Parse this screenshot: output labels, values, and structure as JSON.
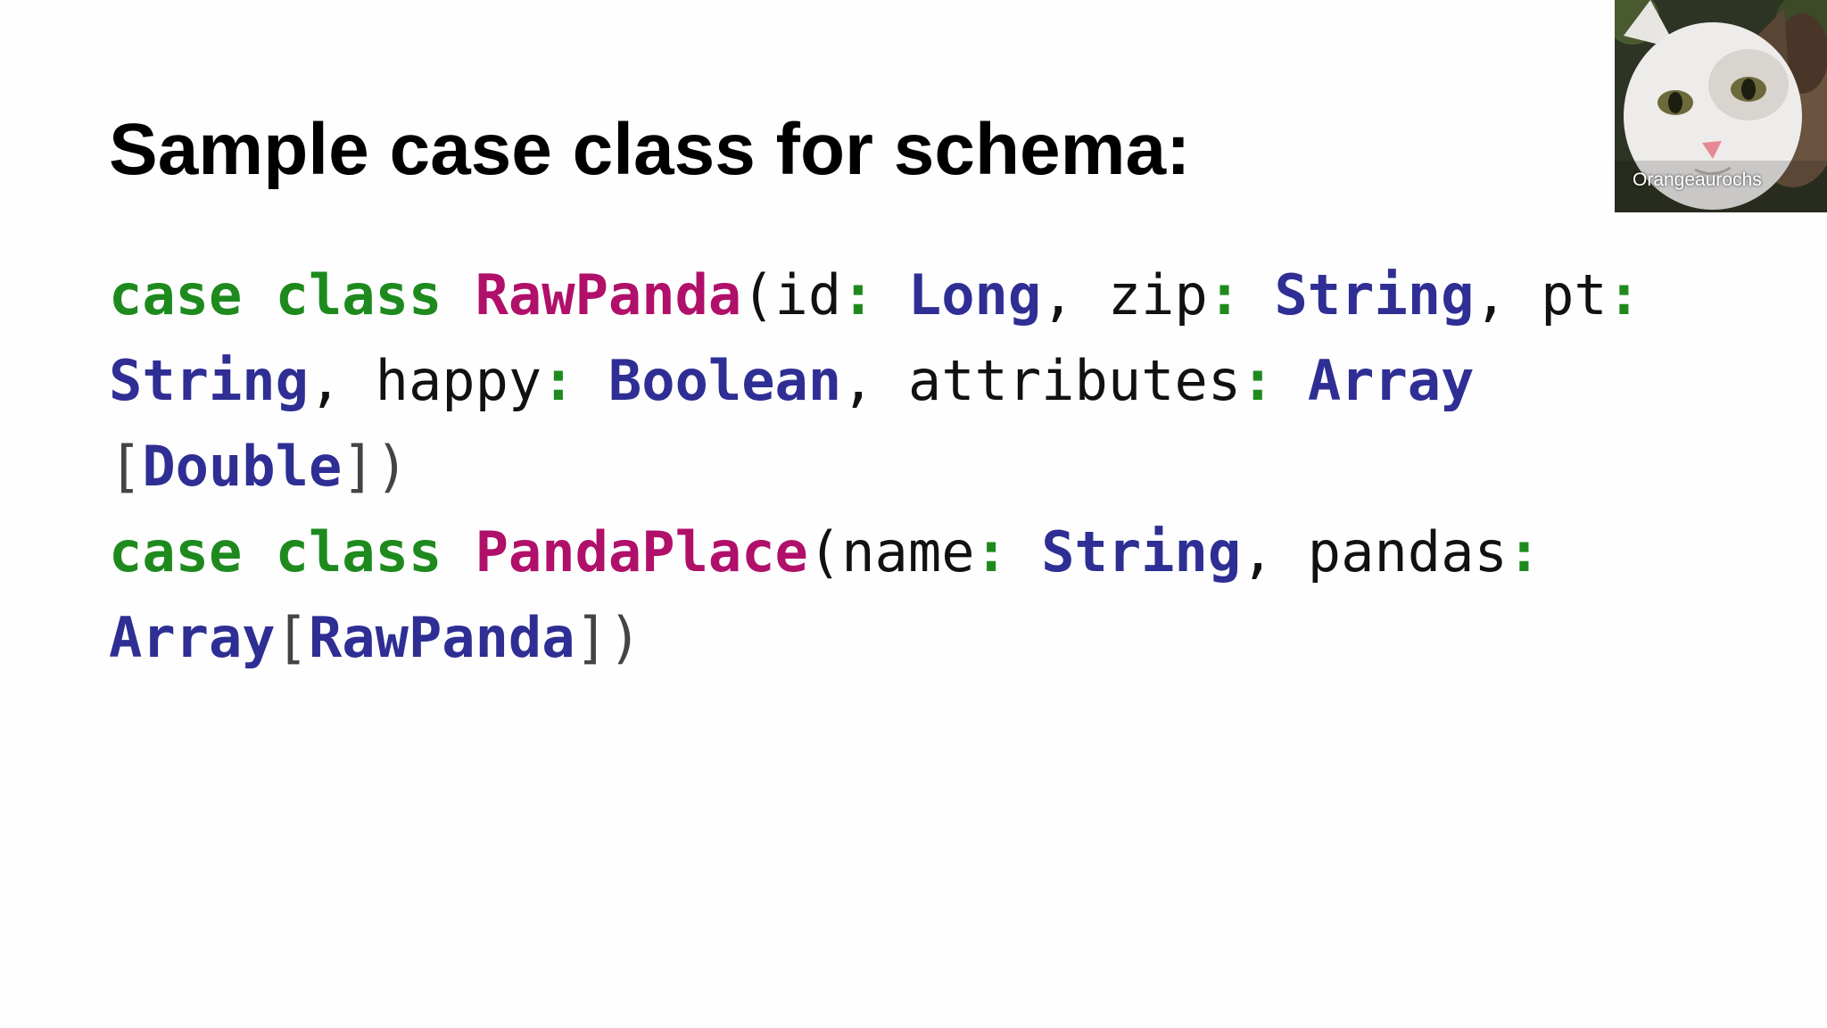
{
  "slide": {
    "title": "Sample case class for schema:"
  },
  "code": {
    "lines": [
      [
        {
          "text": "case class ",
          "kind": "kw"
        },
        {
          "text": "RawPanda",
          "kind": "cls"
        },
        {
          "text": "(id",
          "kind": "plain"
        },
        {
          "text": ":",
          "kind": "pun"
        },
        {
          "text": " ",
          "kind": "plain"
        },
        {
          "text": "Long",
          "kind": "typ"
        },
        {
          "text": ", zip",
          "kind": "plain"
        },
        {
          "text": ":",
          "kind": "pun"
        },
        {
          "text": " ",
          "kind": "plain"
        },
        {
          "text": "String",
          "kind": "typ"
        },
        {
          "text": ", pt",
          "kind": "plain"
        },
        {
          "text": ":",
          "kind": "pun"
        }
      ],
      [
        {
          "text": "String",
          "kind": "typ"
        },
        {
          "text": ", happy",
          "kind": "plain"
        },
        {
          "text": ":",
          "kind": "pun"
        },
        {
          "text": " ",
          "kind": "plain"
        },
        {
          "text": "Boolean",
          "kind": "typ"
        },
        {
          "text": ", attributes",
          "kind": "plain"
        },
        {
          "text": ":",
          "kind": "pun"
        },
        {
          "text": " ",
          "kind": "plain"
        },
        {
          "text": "Array",
          "kind": "typ"
        }
      ],
      [
        {
          "text": "[",
          "kind": "brk"
        },
        {
          "text": "Double",
          "kind": "typ"
        },
        {
          "text": "])",
          "kind": "brk"
        }
      ],
      [
        {
          "text": "case class ",
          "kind": "kw"
        },
        {
          "text": "PandaPlace",
          "kind": "cls"
        },
        {
          "text": "(name",
          "kind": "plain"
        },
        {
          "text": ":",
          "kind": "pun"
        },
        {
          "text": " ",
          "kind": "plain"
        },
        {
          "text": "String",
          "kind": "typ"
        },
        {
          "text": ", pandas",
          "kind": "plain"
        },
        {
          "text": ":",
          "kind": "pun"
        }
      ],
      [
        {
          "text": "Array",
          "kind": "typ"
        },
        {
          "text": "[",
          "kind": "brk"
        },
        {
          "text": "RawPanda",
          "kind": "typ"
        },
        {
          "text": "])",
          "kind": "brk"
        }
      ]
    ]
  },
  "webcam": {
    "speaker_name": "Orangeaurochs"
  },
  "colors": {
    "keyword": "#1e8a1e",
    "class_name": "#b0106a",
    "type": "#2e2e94",
    "text": "#111111"
  }
}
